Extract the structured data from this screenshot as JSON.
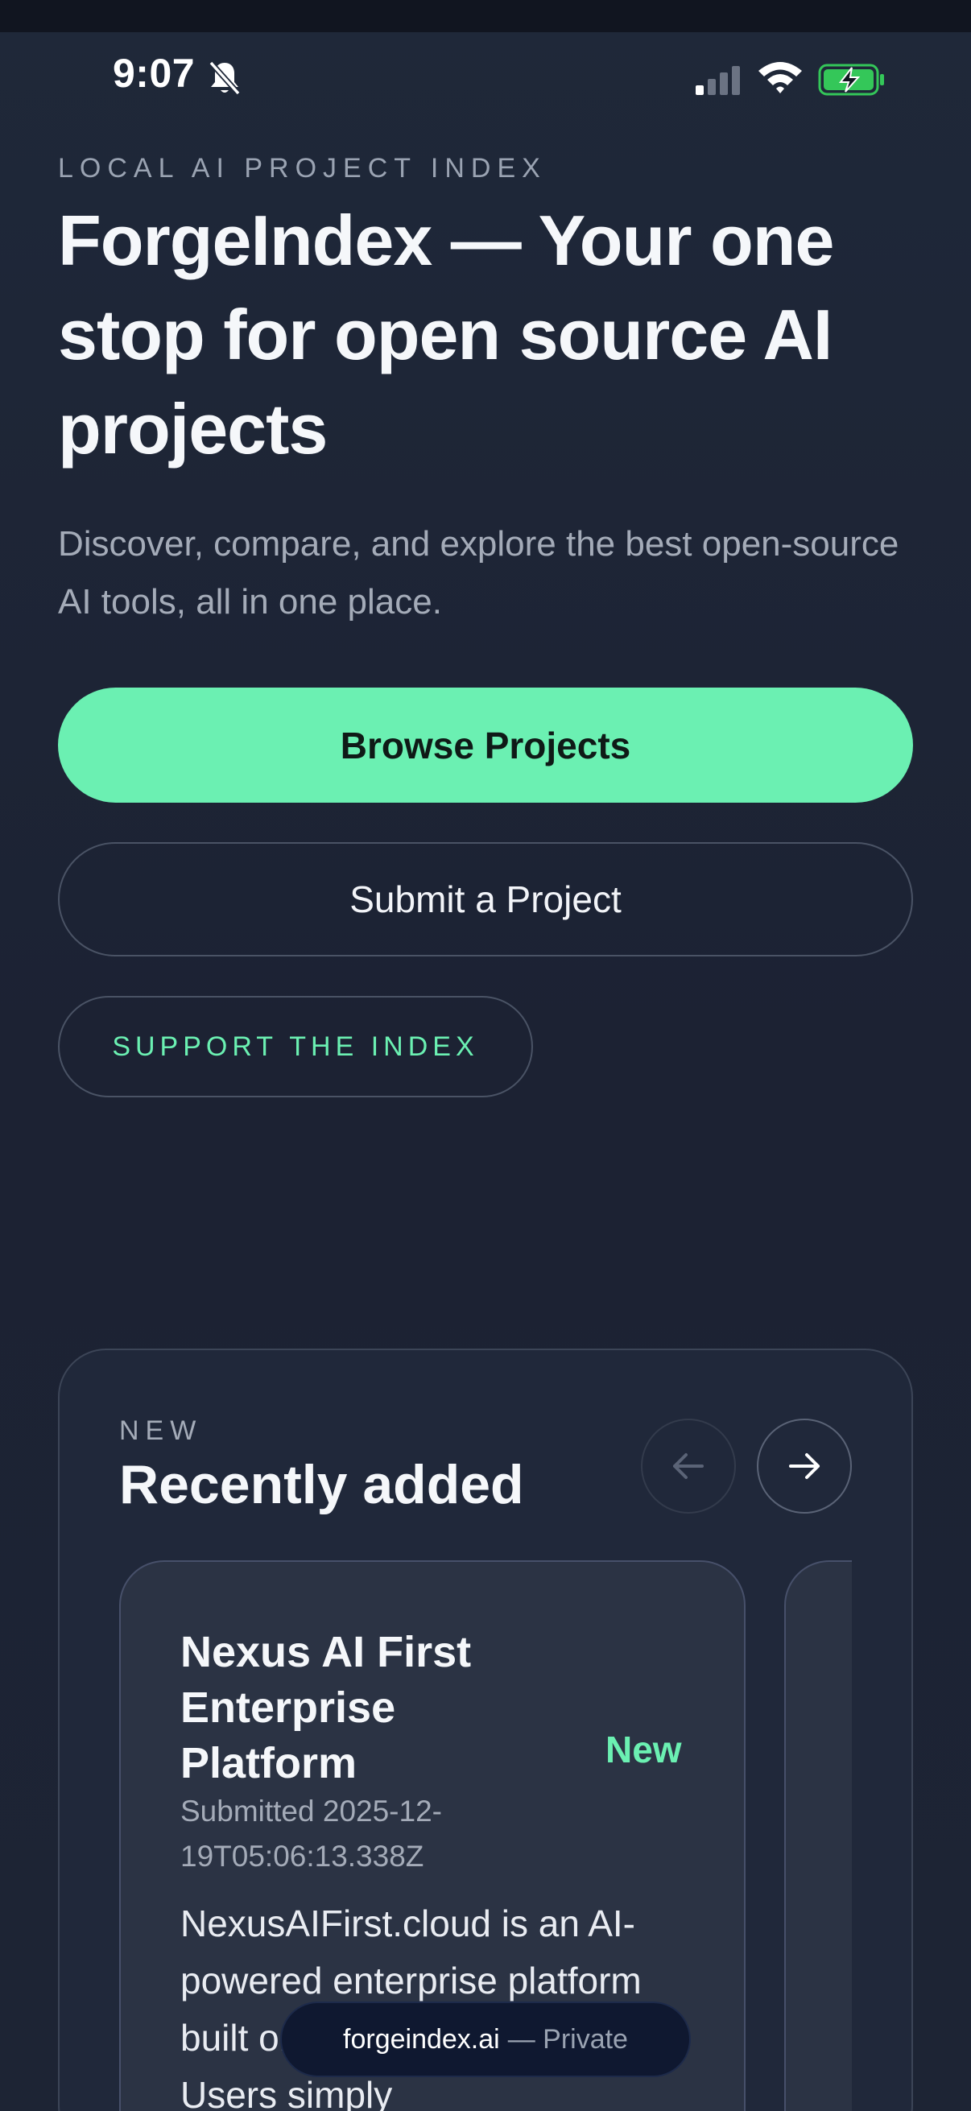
{
  "status_bar": {
    "time": "9:07",
    "icons": [
      "bell-slash-icon",
      "cellular-signal-icon",
      "wifi-icon",
      "battery-charging-icon"
    ]
  },
  "hero": {
    "eyebrow": "LOCAL AI PROJECT INDEX",
    "title": "ForgeIndex — Your one stop for open source AI projects",
    "subtitle": "Discover, compare, and explore the best open-source AI tools, all in one place.",
    "primary_button": "Browse Projects",
    "secondary_button": "Submit a Project",
    "support_button": "SUPPORT THE INDEX"
  },
  "recent": {
    "eyebrow": "NEW",
    "title": "Recently added",
    "prev_icon": "arrow-left-icon",
    "next_icon": "arrow-right-icon",
    "cards": [
      {
        "title": "Nexus AI First Enterprise Platform",
        "badge": "New",
        "submitted": "Submitted 2025-12-19T05:06:13.338Z",
        "description": "NexusAIFirst.cloud is an AI-powered enterprise platform built on an AI-first philosophy. Users simply"
      }
    ]
  },
  "browser": {
    "domain": "forgeindex.ai",
    "mode": "— Private"
  },
  "colors": {
    "accent": "#6bf0b2",
    "background": "#1d2433",
    "card": "#2b3344"
  }
}
